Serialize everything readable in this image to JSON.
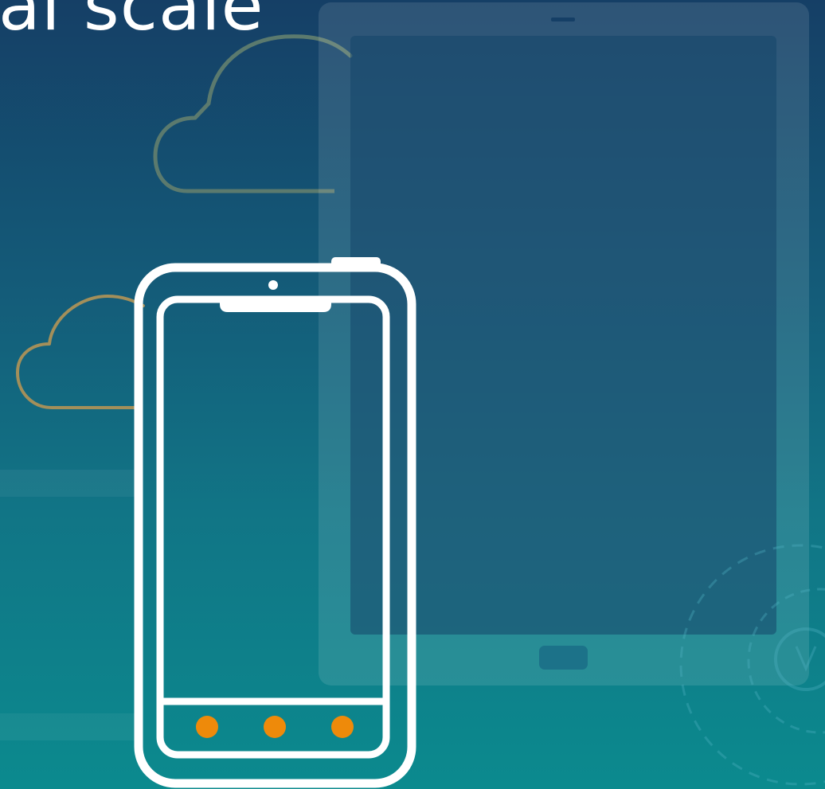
{
  "headline": {
    "text": "al scale"
  },
  "colors": {
    "background_top": "#153f66",
    "background_bottom": "#0b8a8e",
    "device_frame": "#ffffff",
    "tablet_fill": "#4a8fb0",
    "cloud_back": "#5b7a6e",
    "cloud_front": "#a38f5a",
    "dot_accent": "#ee8a0a"
  },
  "icons": [
    "cloud-icon",
    "tablet-icon",
    "smartphone-icon",
    "lightbulb-icon"
  ]
}
